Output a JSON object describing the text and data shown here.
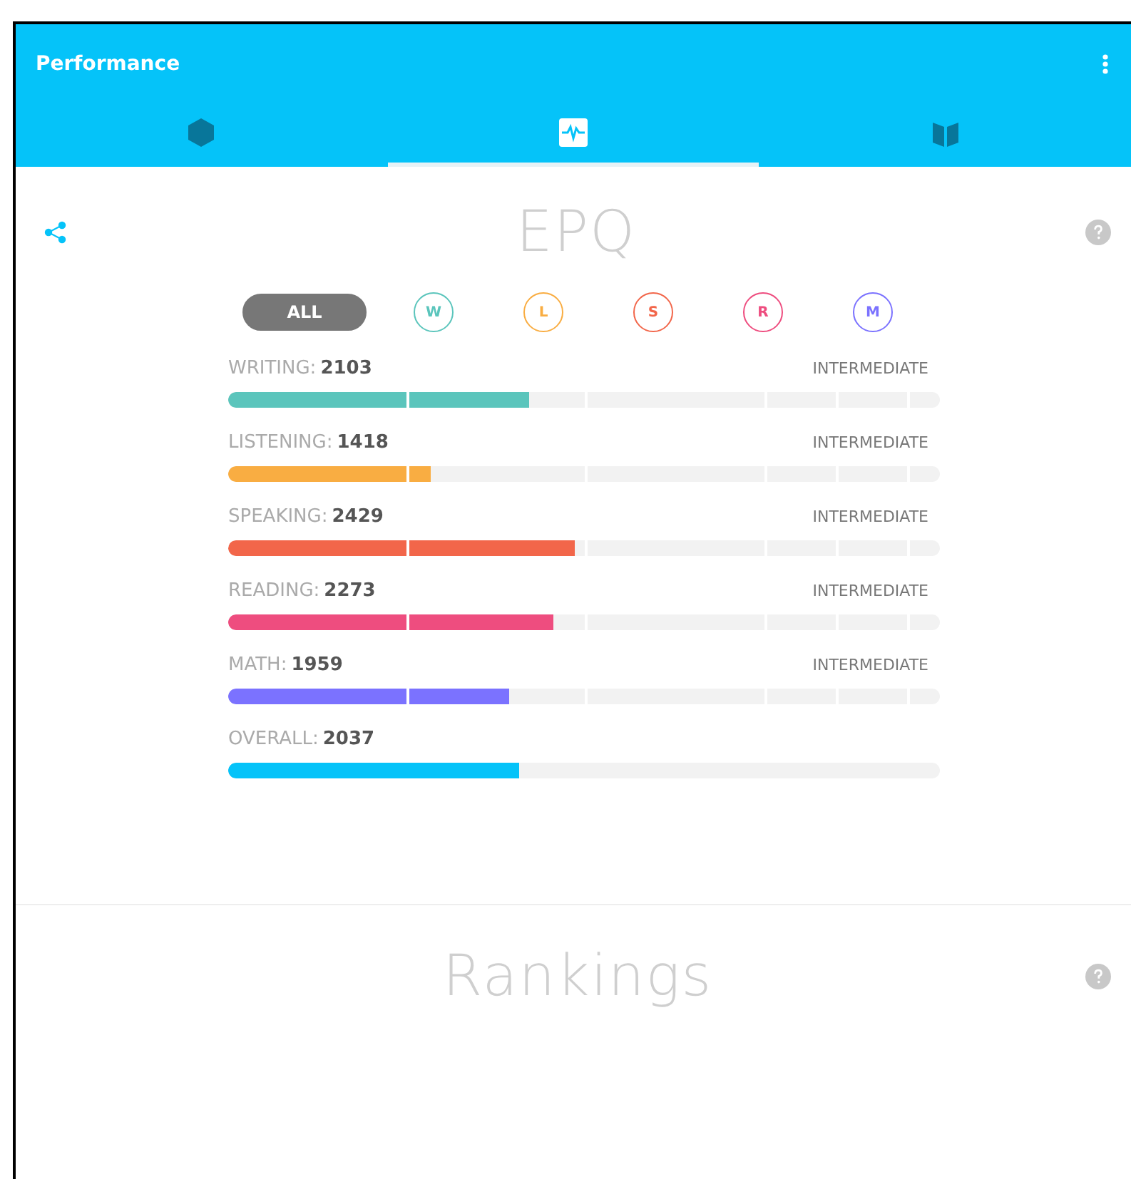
{
  "app_bar": {
    "title": "Performance"
  },
  "tabs": [
    {
      "kind": "hexagon",
      "selected": false
    },
    {
      "kind": "pulse",
      "selected": true
    },
    {
      "kind": "book",
      "selected": false
    }
  ],
  "epq": {
    "title": "EPQ",
    "filters": [
      {
        "label": "ALL",
        "selected": true,
        "color": "#777777"
      },
      {
        "label": "W",
        "selected": false,
        "color": "#5bc5bc"
      },
      {
        "label": "L",
        "selected": false,
        "color": "#f9ad42"
      },
      {
        "label": "S",
        "selected": false,
        "color": "#f2664a"
      },
      {
        "label": "R",
        "selected": false,
        "color": "#ee4d7f"
      },
      {
        "label": "M",
        "selected": false,
        "color": "#7b72ff"
      }
    ],
    "skills": [
      {
        "label": "WRITING:",
        "score": "2103",
        "rating": "INTERMEDIATE",
        "level": 0.423,
        "color": "#5bc5bc",
        "kind": "segmented"
      },
      {
        "label": "LISTENING:",
        "score": "1418",
        "rating": "INTERMEDIATE",
        "level": 0.285,
        "color": "#f9ad42",
        "kind": "segmented"
      },
      {
        "label": "SPEAKING:",
        "score": "2429",
        "rating": "INTERMEDIATE",
        "level": 0.487,
        "color": "#f2664a",
        "kind": "segmented"
      },
      {
        "label": "READING:",
        "score": "2273",
        "rating": "INTERMEDIATE",
        "level": 0.457,
        "color": "#ee4d7f",
        "kind": "segmented"
      },
      {
        "label": "MATH:",
        "score": "1959",
        "rating": "INTERMEDIATE",
        "level": 0.395,
        "color": "#7b72ff",
        "kind": "segmented"
      },
      {
        "label": "OVERALL:",
        "score": "2037",
        "level": 0.409,
        "color": "#05c3f9",
        "kind": "plain"
      }
    ]
  },
  "rankings": {
    "title": "Rankings"
  }
}
